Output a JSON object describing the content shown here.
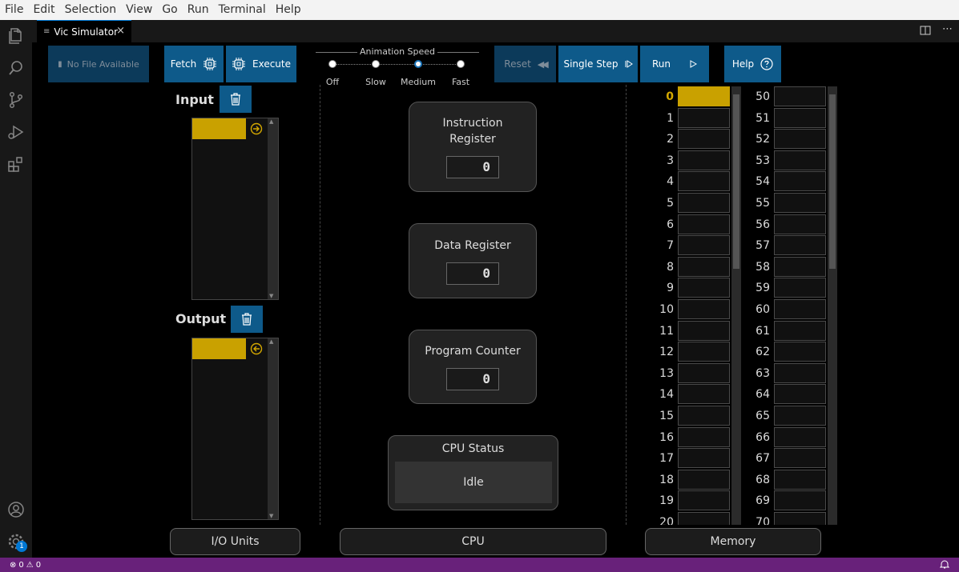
{
  "menu": [
    "File",
    "Edit",
    "Selection",
    "View",
    "Go",
    "Run",
    "Terminal",
    "Help"
  ],
  "tab": {
    "title": "Vic Simulator",
    "close": "×"
  },
  "toolbar": {
    "no_file": "No File Available",
    "fetch": "Fetch",
    "execute": "Execute",
    "reset": "Reset",
    "single_step": "Single Step",
    "run": "Run",
    "help": "Help"
  },
  "animation_speed": {
    "title": "Animation Speed",
    "options": [
      "Off",
      "Slow",
      "Medium",
      "Fast"
    ],
    "selected": "Medium"
  },
  "io": {
    "input_title": "Input",
    "output_title": "Output"
  },
  "cpu": {
    "instruction_register_label": "Instruction Register",
    "instruction_register_value": "0",
    "data_register_label": "Data Register",
    "data_register_value": "0",
    "program_counter_label": "Program Counter",
    "program_counter_value": "0",
    "status_label": "CPU Status",
    "status_value": "Idle"
  },
  "memory": {
    "left_addresses": [
      "0",
      "1",
      "2",
      "3",
      "4",
      "5",
      "6",
      "7",
      "8",
      "9",
      "10",
      "11",
      "12",
      "13",
      "14",
      "15",
      "16",
      "17",
      "18",
      "19",
      "20"
    ],
    "right_addresses": [
      "50",
      "51",
      "52",
      "53",
      "54",
      "55",
      "56",
      "57",
      "58",
      "59",
      "60",
      "61",
      "62",
      "63",
      "64",
      "65",
      "66",
      "67",
      "68",
      "69",
      "70"
    ],
    "current_address": "0"
  },
  "sections": {
    "io_units": "I/O Units",
    "cpu": "CPU",
    "memory": "Memory"
  },
  "statusbar": {
    "errors": "0",
    "warnings": "0",
    "accounts_badge": "1"
  },
  "colors": {
    "button_bg": "#0e5a8a",
    "highlight": "#c9a100",
    "statusbar": "#68217a"
  }
}
